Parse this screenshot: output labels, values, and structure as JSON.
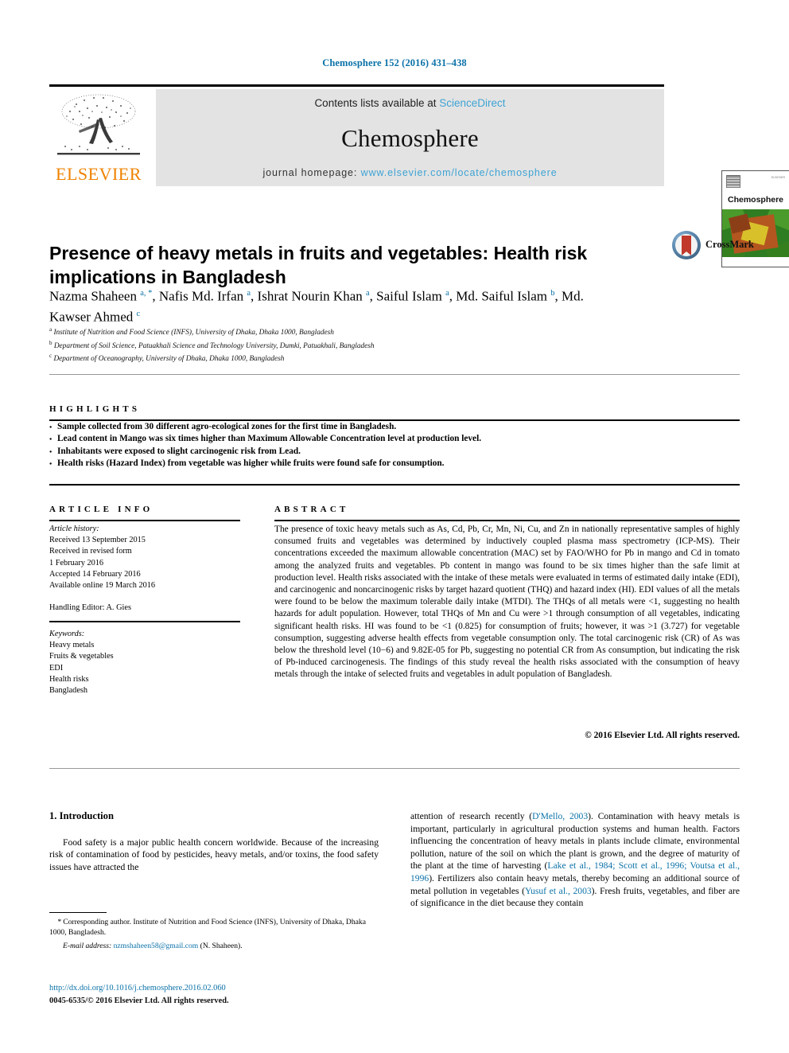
{
  "running_head": "Chemosphere 152 (2016) 431–438",
  "masthead": {
    "publisher": "ELSEVIER",
    "contents_prefix": "Contents lists available at ",
    "contents_link": "ScienceDirect",
    "journal_name": "Chemosphere",
    "homepage_label": "journal homepage: ",
    "homepage_url": "www.elsevier.com/locate/chemosphere",
    "cover_title": "Chemosphere",
    "cover_corner_text": "ELSEVIER"
  },
  "crossmark": {
    "label": "CrossMark"
  },
  "article": {
    "title": "Presence of heavy metals in fruits and vegetables: Health risk implications in Bangladesh",
    "authors_html": "Nazma Shaheen <sup class=\"sup\">a, *</sup>, Nafis Md. Irfan <sup class=\"sup\">a</sup>, Ishrat Nourin Khan <sup class=\"sup\">a</sup>, Saiful Islam <sup class=\"sup\">a</sup>, Md. Saiful Islam <sup class=\"sup\">b</sup>, Md. Kawser Ahmed <sup class=\"sup\">c</sup>",
    "affiliations": [
      {
        "label": "a",
        "text": "Institute of Nutrition and Food Science (INFS), University of Dhaka, Dhaka 1000, Bangladesh"
      },
      {
        "label": "b",
        "text": "Department of Soil Science, Patuakhali Science and Technology University, Dumki, Patuakhali, Bangladesh"
      },
      {
        "label": "c",
        "text": "Department of Oceanography, University of Dhaka, Dhaka 1000, Bangladesh"
      }
    ]
  },
  "highlights": {
    "heading": "HIGHLIGHTS",
    "items": [
      "Sample collected from 30 different agro-ecological zones for the first time in Bangladesh.",
      "Lead content in Mango was six times higher than Maximum Allowable Concentration level at production level.",
      "Inhabitants were exposed to slight carcinogenic risk from Lead.",
      "Health risks (Hazard Index) from vegetable was higher while fruits were found safe for consumption."
    ]
  },
  "article_info": {
    "heading": "ARTICLE INFO",
    "history_label": "Article history:",
    "history": [
      "Received 13 September 2015",
      "Received in revised form",
      "1 February 2016",
      "Accepted 14 February 2016",
      "Available online 19 March 2016"
    ],
    "handling_editor": "Handling Editor: A. Gies",
    "keywords_label": "Keywords:",
    "keywords": [
      "Heavy metals",
      "Fruits & vegetables",
      "EDI",
      "Health risks",
      "Bangladesh"
    ]
  },
  "abstract": {
    "heading": "ABSTRACT",
    "text": "The presence of toxic heavy metals such as As, Cd, Pb, Cr, Mn, Ni, Cu, and Zn in nationally representative samples of highly consumed fruits and vegetables was determined by inductively coupled plasma mass spectrometry (ICP-MS). Their concentrations exceeded the maximum allowable concentration (MAC) set by FAO/WHO for Pb in mango and Cd in tomato among the analyzed fruits and vegetables. Pb content in mango was found to be six times higher than the safe limit at production level. Health risks associated with the intake of these metals were evaluated in terms of estimated daily intake (EDI), and carcinogenic and noncarcinogenic risks by target hazard quotient (THQ) and hazard index (HI). EDI values of all the metals were found to be below the maximum tolerable daily intake (MTDI). The THQs of all metals were <1, suggesting no health hazards for adult population. However, total THQs of Mn and Cu were >1 through consumption of all vegetables, indicating significant health risks. HI was found to be <1 (0.825) for consumption of fruits; however, it was >1 (3.727) for vegetable consumption, suggesting adverse health effects from vegetable consumption only. The total carcinogenic risk (CR) of As was below the threshold level (10−6) and 9.82E-05 for Pb, suggesting no potential CR from As consumption, but indicating the risk of Pb-induced carcinogenesis. The findings of this study reveal the health risks associated with the consumption of heavy metals through the intake of selected fruits and vegetables in adult population of Bangladesh.",
    "copyright": "© 2016 Elsevier Ltd. All rights reserved."
  },
  "body": {
    "section_number_title": "1. Introduction",
    "left_paragraph": "Food safety is a major public health concern worldwide. Because of the increasing risk of contamination of food by pesticides, heavy metals, and/or toxins, the food safety issues have attracted the",
    "right_paragraph_html": "attention of research recently (<span class=\"cite\">D'Mello, 2003</span>). Contamination with heavy metals is important, particularly in agricultural production systems and human health. Factors influencing the concentration of heavy metals in plants include climate, environmental pollution, nature of the soil on which the plant is grown, and the degree of maturity of the plant at the time of harvesting (<span class=\"cite\">Lake et al., 1984; Scott et al., 1996; Voutsa et al., 1996</span>). Fertilizers also contain heavy metals, thereby becoming an additional source of metal pollution in vegetables (<span class=\"cite\">Yusuf et al., 2003</span>). Fresh fruits, vegetables, and fiber are of significance in the diet because they contain"
  },
  "footnote": {
    "corresponding_html": "<span class=\"em\">*</span> Corresponding author. Institute of Nutrition and Food Science (INFS), University of Dhaka, Dhaka 1000, Bangladesh.",
    "email_label": "E-mail address:",
    "email": "nzmshaheen58@gmail.com",
    "email_suffix": "(N. Shaheen)."
  },
  "footer": {
    "doi": "http://dx.doi.org/10.1016/j.chemosphere.2016.02.060",
    "issn": "0045-6535/© 2016 Elsevier Ltd. All rights reserved."
  },
  "colors": {
    "link_blue": "#0b72a8",
    "sd_blue": "#3ea3d4",
    "elsevier_orange": "#ef8200",
    "masthead_grey": "#e3e3e3"
  }
}
